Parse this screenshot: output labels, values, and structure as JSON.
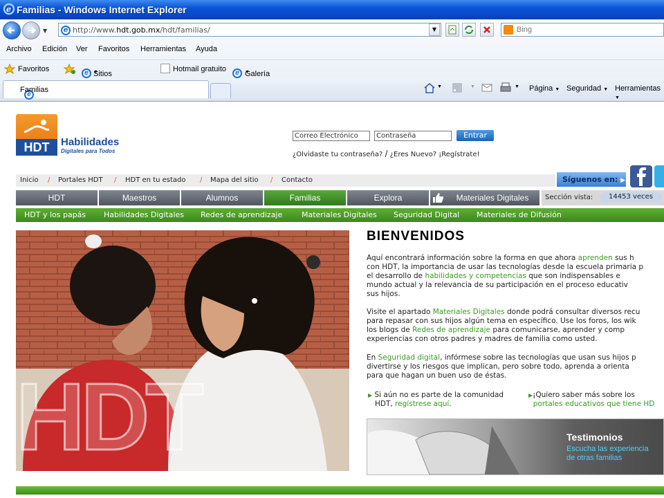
{
  "window": {
    "title": "Familias - Windows Internet Explorer"
  },
  "address": {
    "url_prefix": "http://www.",
    "url_domain": "hdt.gob.mx",
    "url_path": "/hdt/familias/",
    "search_placeholder": "Bing"
  },
  "menu": [
    "Archivo",
    "Edición",
    "Ver",
    "Favoritos",
    "Herramientas",
    "Ayuda"
  ],
  "favorites": {
    "label": "Favoritos",
    "items": [
      "Sitios sugeridos",
      "Hotmail gratuito",
      "Galería de Web Slice"
    ]
  },
  "tab": {
    "label": "Familias"
  },
  "commands": [
    "Página",
    "Seguridad",
    "Herramientas"
  ],
  "site": {
    "logo_text": "HDT",
    "logo_name": "Habilidades",
    "logo_sub": "Digitales para Todos",
    "login": {
      "email_placeholder": "Correo Electrónico",
      "password_placeholder": "Contraseña",
      "submit": "Entrar",
      "forgot": "¿Olvidaste tu contraseña?",
      "sep": "/",
      "new": "¿Eres Nuevo? ¡Regístrate!"
    },
    "breadcrumbs": [
      "Inicio",
      "Portales HDT",
      "HDT en tu estado",
      "Mapa del sitio",
      "Contacto"
    ],
    "crumb_sep": "/",
    "follow": "Síguenos en:",
    "main_nav": [
      "HDT",
      "Maestros",
      "Alumnos",
      "Familias",
      "Explora",
      "Materiales Digitales"
    ],
    "section_views_label": "Sección vista:",
    "section_views_value": "14453 veces",
    "sub_nav": [
      "HDT y los papás",
      "Habilidades Digitales",
      "Redes de aprendizaje",
      "Materiales Digitales",
      "Seguridad Digital",
      "Materiales de Difusión"
    ],
    "photo_text": "HDT",
    "welcome": "BIENVENIDOS",
    "p1": {
      "l1a": "Aquí encontrará información sobre la forma en que ahora ",
      "l1b": "aprenden",
      "l1c": " sus h",
      "l2": "con HDT, la importancia de usar las tecnologías desde la escuela primaria p",
      "l3a": "el desarrollo de ",
      "l3b": "habilidades y competencias",
      "l3c": " que son indispensables e",
      "l4": "mundo actual y la relevancia de su participación en el proceso educativ",
      "l5": "sus hijos."
    },
    "p2": {
      "l1a": "Visite el apartado ",
      "l1b": "Materiales Digitales",
      "l1c": " donde podrá consultar diversos recu",
      "l2": "para repasar con sus hijos algún tema en específico. Use los foros, los wik",
      "l3a": "los blogs de ",
      "l3b": "Redes de aprendizaje",
      "l3c": " para comunicarse, aprender y comp",
      "l4": "experiencias con otros padres y madres de familia como usted."
    },
    "p3": {
      "l1a": "En ",
      "l1b": "Seguridad digital",
      "l1c": ", infórmese sobre las tecnologías que usan sus hijos p",
      "l2": "divertirse y los riesgos que implican, pero sobre todo, aprenda a orienta",
      "l3": "para que hagan un buen uso de éstas."
    },
    "bullet1": {
      "a": "Si aún no es parte de la comunidad",
      "b": "HDT, ",
      "c": "regístrese aquí",
      "d": "."
    },
    "bullet2": {
      "a": "¡Quiero saber más sobre los",
      "b": "portales educativos que tiene HD"
    },
    "testimonials": {
      "title": "Testimonios",
      "l1": "Escucha las experiencia",
      "l2": "de otras familias"
    }
  }
}
